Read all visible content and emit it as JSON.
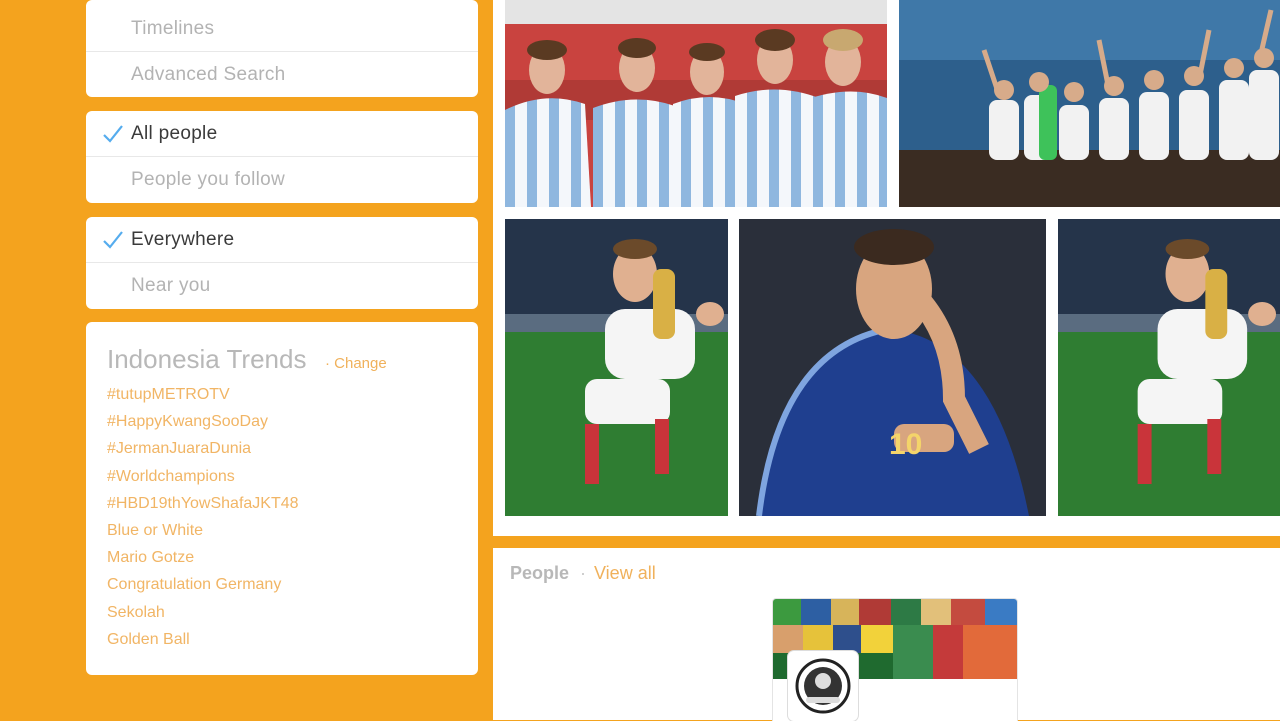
{
  "sidebar": {
    "search_menu": [
      {
        "label": "Timelines"
      },
      {
        "label": "Advanced Search"
      }
    ],
    "people_filter": [
      {
        "label": "All people",
        "selected": true
      },
      {
        "label": "People you follow",
        "selected": false
      }
    ],
    "location_filter": [
      {
        "label": "Everywhere",
        "selected": true
      },
      {
        "label": "Near you",
        "selected": false
      }
    ],
    "trends": {
      "title": "Indonesia Trends",
      "change_label": "· Change",
      "items": [
        "#tutupMETROTV",
        "#HappyKwangSooDay",
        "#JermanJuaraDunia",
        "#Worldchampions",
        "#HBD19thYowShafaJKT48",
        "Blue or White",
        "Mario Gotze",
        "Congratulation Germany",
        "Sekolah",
        "Golden Ball"
      ]
    }
  },
  "media": {
    "photos": [
      {
        "icon": "team-in-striped-jerseys-photo"
      },
      {
        "icon": "team-celebration-photo"
      },
      {
        "icon": "player-with-trophy-photo"
      },
      {
        "icon": "player-in-blue-jersey-photo"
      },
      {
        "icon": "player-with-trophy-photo"
      }
    ],
    "jersey_number": "10"
  },
  "people": {
    "title": "People",
    "separator": "·",
    "view_all": "View all"
  },
  "colors": {
    "background": "#f4a31e",
    "check": "#55acee",
    "accent_text": "#f1b565",
    "muted_text": "#b3b3b3"
  }
}
